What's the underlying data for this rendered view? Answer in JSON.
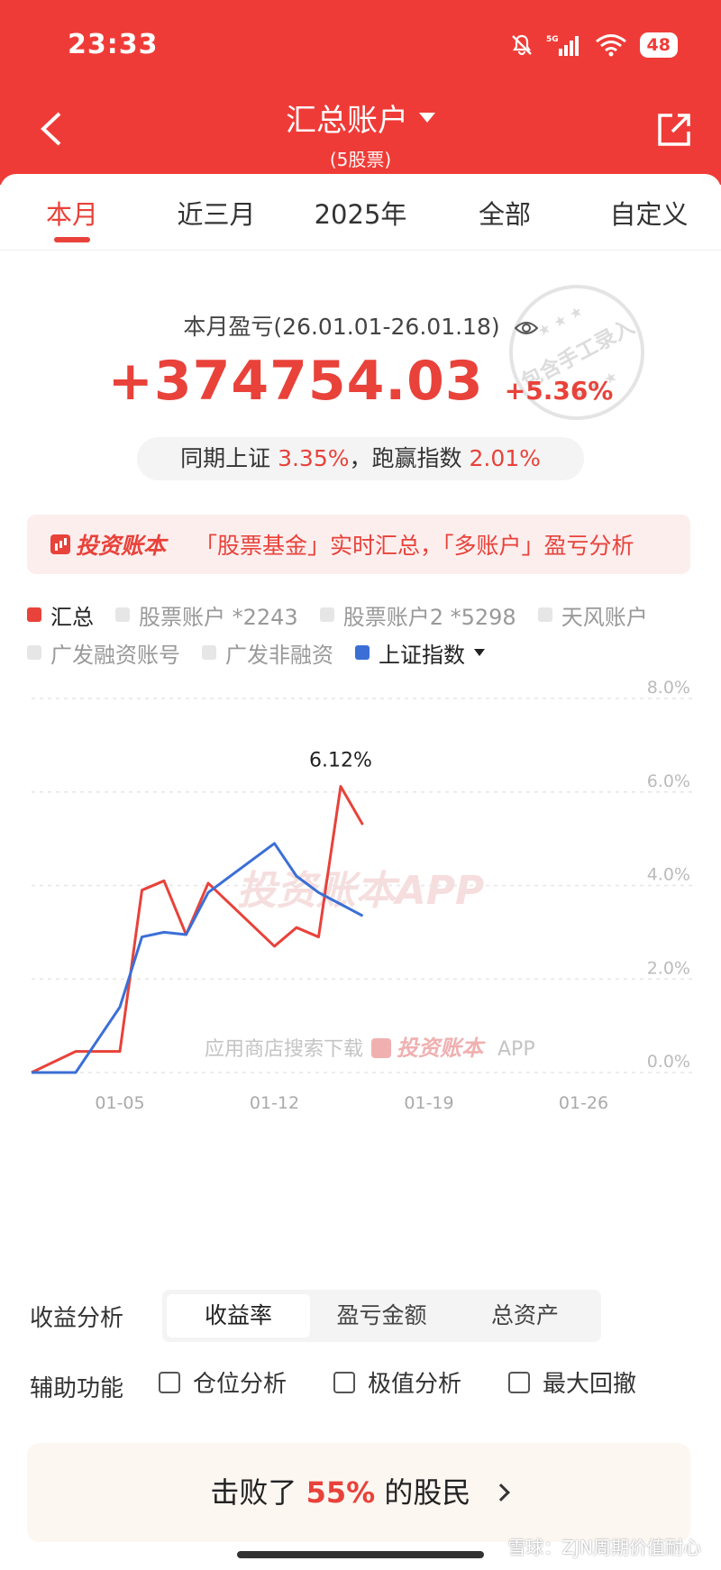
{
  "status_bar": {
    "time": "23:33",
    "network": "5G",
    "battery": "48"
  },
  "header": {
    "title": "汇总账户",
    "subtitle": "(5股票)"
  },
  "tabs": [
    "本月",
    "近三月",
    "2025年",
    "全部",
    "自定义"
  ],
  "active_tab": "本月",
  "summary": {
    "label": "本月盈亏(26.01.01-26.01.18)",
    "profit": "+374754.03",
    "percent": "+5.36%",
    "compare_prefix": "同期上证",
    "compare_index": "3.35%",
    "compare_mid": "，跑赢指数",
    "compare_beat": "2.01%"
  },
  "stamp": {
    "text": "包含手工录入"
  },
  "banner": {
    "brand": "投资账本",
    "text": "「股票基金」实时汇总，「多账户」盈亏分析"
  },
  "legend": {
    "row1": [
      "汇总",
      "股票账户 *2243",
      "股票账户2 *5298",
      "天风账户"
    ],
    "row2": [
      "广发融资账号",
      "广发非融资",
      "上证指数"
    ]
  },
  "chart_data": {
    "type": "line",
    "ylim": [
      0,
      8
    ],
    "yticks": [
      "0.0%",
      "2.0%",
      "4.0%",
      "6.0%",
      "8.0%"
    ],
    "xticks": [
      "01-05",
      "01-12",
      "01-19",
      "01-26"
    ],
    "grid": true,
    "watermark": "投资账本APP",
    "footer_note": "应用商店搜索下载",
    "footer_brand": "投资账本",
    "footer_app": "APP",
    "peak_label": "6.12%",
    "series": [
      {
        "name": "汇总",
        "color": "#e8423a",
        "x": [
          "01-01",
          "01-03",
          "01-05",
          "01-06",
          "01-07",
          "01-08",
          "01-09",
          "01-12",
          "01-13",
          "01-14",
          "01-15",
          "01-16"
        ],
        "values": [
          0.0,
          0.45,
          0.45,
          3.9,
          4.1,
          2.95,
          4.05,
          2.7,
          3.1,
          2.9,
          6.12,
          5.3
        ]
      },
      {
        "name": "上证指数",
        "color": "#3b6fd6",
        "x": [
          "01-01",
          "01-03",
          "01-05",
          "01-06",
          "01-07",
          "01-08",
          "01-09",
          "01-12",
          "01-13",
          "01-14",
          "01-15",
          "01-16"
        ],
        "values": [
          0.0,
          0.0,
          1.4,
          2.9,
          3.0,
          2.95,
          3.85,
          4.9,
          4.2,
          3.85,
          3.6,
          3.35
        ]
      }
    ]
  },
  "analysis": {
    "label": "收益分析",
    "options": [
      "收益率",
      "盈亏金额",
      "总资产"
    ],
    "active": "收益率"
  },
  "aux": {
    "label": "辅助功能",
    "options": [
      "仓位分析",
      "极值分析",
      "最大回撤"
    ]
  },
  "beat": {
    "prefix": "击败了",
    "percent": "55%",
    "suffix": "的股民"
  },
  "watermark": "雪球：ZJN周期价值耐心"
}
